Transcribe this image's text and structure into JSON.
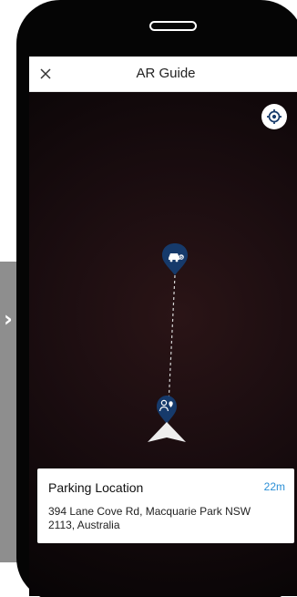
{
  "header": {
    "title": "AR Guide",
    "close_icon": "close-icon"
  },
  "controls": {
    "locate_icon": "crosshair-icon"
  },
  "route": {
    "destination_icon": "parking-car-icon",
    "user_icon": "user-location-icon",
    "direction_icon": "navigation-arrow-icon",
    "accent_color": "#163a6b"
  },
  "destination_card": {
    "title": "Parking Location",
    "distance": "22m",
    "address": "394 Lane Cove Rd, Macquarie Park NSW 2113, Australia"
  },
  "colors": {
    "phone_frame": "#050505",
    "screen_background": "#1b0d10",
    "distance_color": "#2b8fd6",
    "side_strip": "#8e8e8e"
  }
}
